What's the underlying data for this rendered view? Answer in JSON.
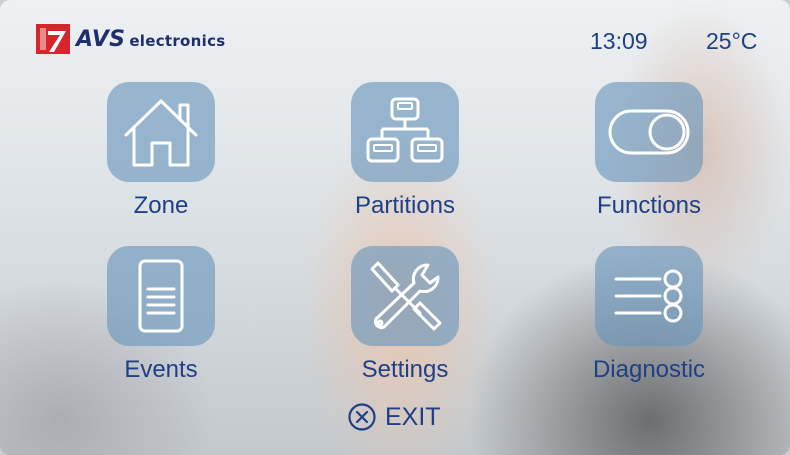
{
  "header": {
    "brand": "AVS electronics",
    "brand_parts": {
      "mark": "AVS",
      "suffix": "electronics"
    },
    "time": "13:09",
    "temperature": "25°C"
  },
  "menu": {
    "items": [
      {
        "label": "Zone",
        "icon": "house-icon"
      },
      {
        "label": "Partitions",
        "icon": "hierarchy-icon"
      },
      {
        "label": "Functions",
        "icon": "toggle-switch-icon"
      },
      {
        "label": "Events",
        "icon": "document-list-icon"
      },
      {
        "label": "Settings",
        "icon": "wrench-screwdriver-icon"
      },
      {
        "label": "Diagnostic",
        "icon": "list-circles-icon"
      }
    ]
  },
  "exit": {
    "label": "EXIT",
    "icon": "close-circle-icon"
  },
  "colors": {
    "text_blue": "#1f3f86",
    "tile_blue": "#6794bc",
    "icon_white": "#ffffff",
    "logo_red": "#d6252b",
    "logo_navy": "#1f2f6e"
  }
}
